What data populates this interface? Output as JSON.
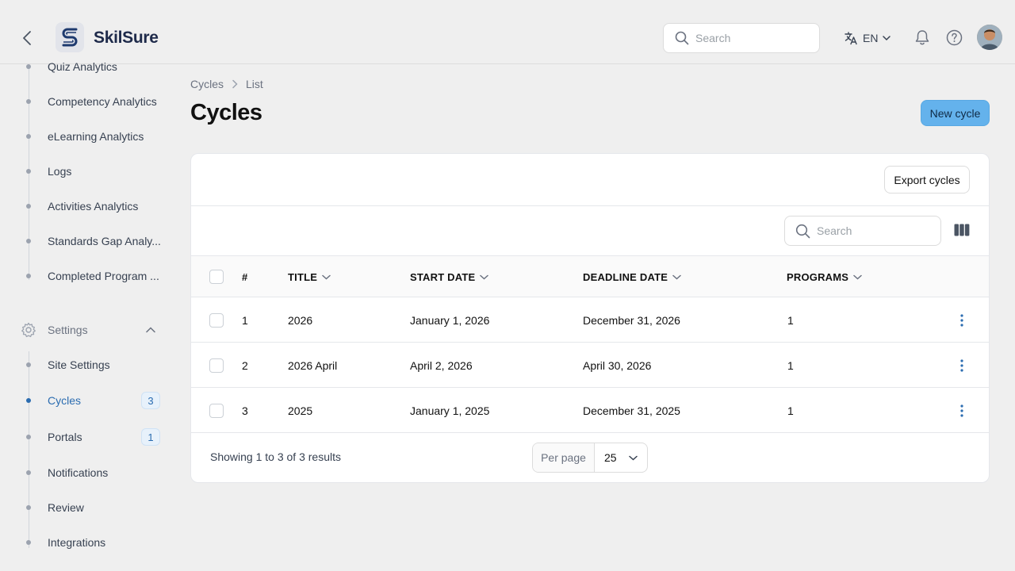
{
  "header": {
    "brand": "SkilSure",
    "search_placeholder": "Search",
    "language": "EN"
  },
  "sidebar": {
    "analytics_items": [
      {
        "label": "Quiz Analytics"
      },
      {
        "label": "Competency Analytics"
      },
      {
        "label": "eLearning Analytics"
      },
      {
        "label": "Logs"
      },
      {
        "label": "Activities Analytics"
      },
      {
        "label": "Standards Gap Analy..."
      },
      {
        "label": "Completed Program ..."
      }
    ],
    "settings_label": "Settings",
    "settings_items": [
      {
        "label": "Site Settings",
        "badge": null
      },
      {
        "label": "Cycles",
        "badge": "3",
        "active": true
      },
      {
        "label": "Portals",
        "badge": "1"
      },
      {
        "label": "Notifications",
        "badge": null
      },
      {
        "label": "Review",
        "badge": null
      },
      {
        "label": "Integrations",
        "badge": null
      }
    ]
  },
  "breadcrumb": {
    "root": "Cycles",
    "current": "List"
  },
  "page": {
    "title": "Cycles",
    "new_button": "New cycle"
  },
  "table": {
    "export_button": "Export cycles",
    "search_placeholder": "Search",
    "columns": [
      "#",
      "TITLE",
      "START DATE",
      "DEADLINE DATE",
      "PROGRAMS"
    ],
    "rows": [
      {
        "num": "1",
        "title": "2026",
        "start": "January 1, 2026",
        "deadline": "December 31, 2026",
        "programs": "1"
      },
      {
        "num": "2",
        "title": "2026 April",
        "start": "April 2, 2026",
        "deadline": "April 30, 2026",
        "programs": "1"
      },
      {
        "num": "3",
        "title": "2025",
        "start": "January 1, 2025",
        "deadline": "December 31, 2025",
        "programs": "1"
      }
    ],
    "showing": "Showing 1 to 3 of 3 results",
    "per_page_label": "Per page",
    "per_page_value": "25"
  },
  "colors": {
    "accent": "#2b6cb0",
    "primary_button": "#64b2ec"
  }
}
